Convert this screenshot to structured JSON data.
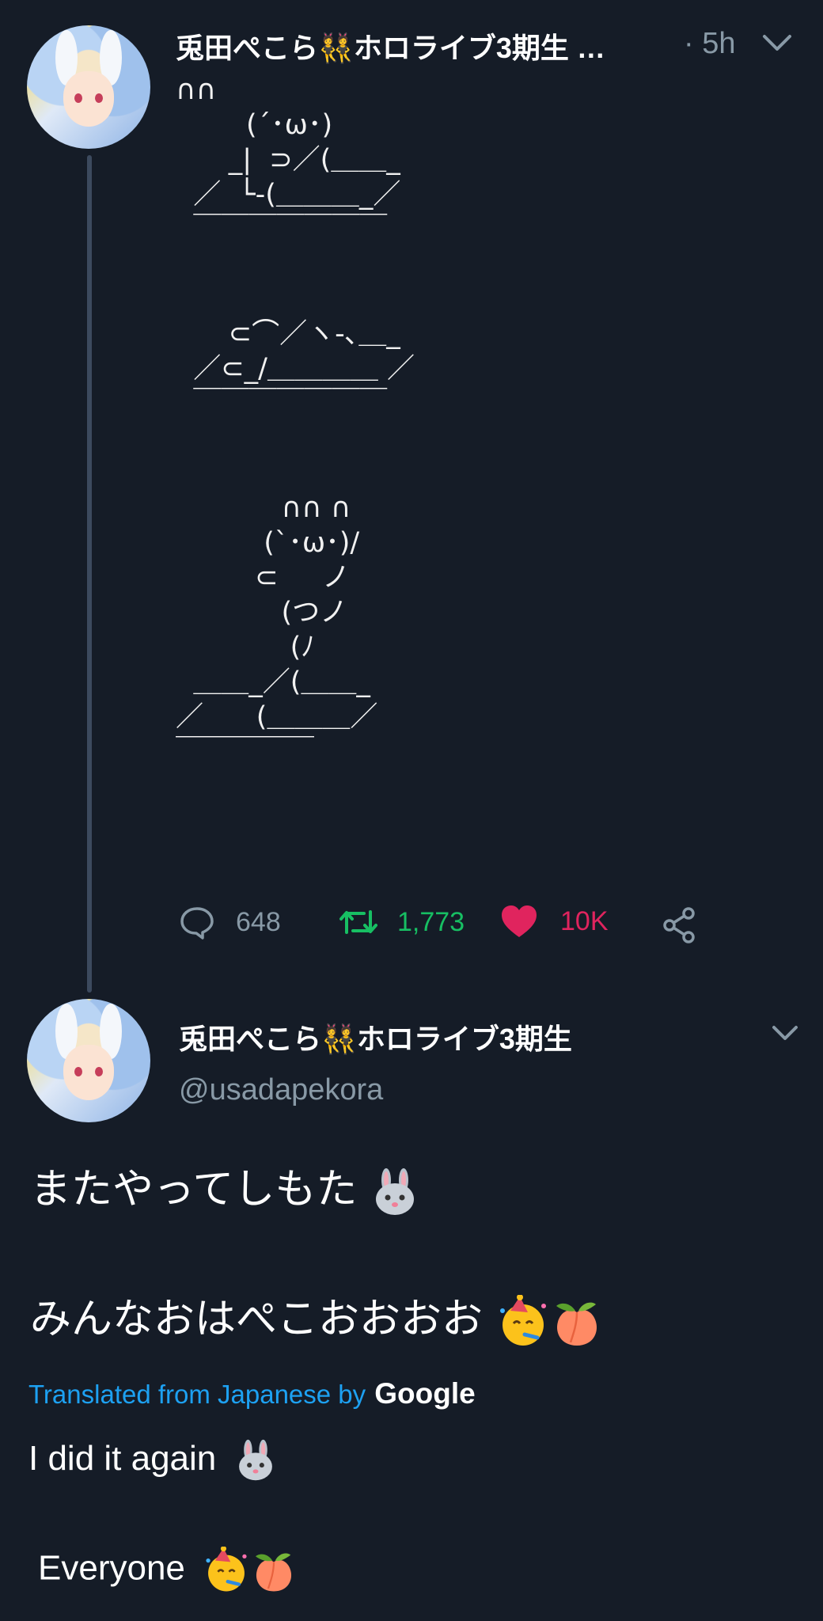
{
  "tweet1": {
    "display_name": "兎田ぺこら👯ホロライブ3期生 …",
    "time": "· 5h",
    "ascii_lines": [
      "∩∩",
      "        (´･ω･)",
      "      _|  ⊃／(＿＿_",
      "  ／  └-(＿＿＿_／",
      "  ￣￣￣￣￣￣￣",
      "",
      "",
      "      ⊂⌒／ヽ-､＿_",
      "  ／⊂_/＿＿＿＿ ／",
      "  ￣￣￣￣￣￣￣",
      "",
      "",
      "            ∩∩ ∩",
      "          (`･ω･)/",
      "         ⊂     ノ",
      "            (つノ",
      "             (ﾉ",
      "  ＿＿_／(＿＿_",
      "／      (＿＿＿／",
      "￣￣￣￣￣"
    ],
    "replies": "648",
    "retweets": "1,773",
    "likes": "10K"
  },
  "tweet2": {
    "display_name": "兎田ぺこら👯ホロライブ3期生",
    "handle": "@usadapekora",
    "line1": "またやってしもた",
    "line2": "みんなおはぺこおおおお",
    "translated_prefix": "Translated from Japanese by",
    "translated_by": "Google",
    "en_line1": "I did it again",
    "en_line2": "Everyone"
  },
  "colors": {
    "background": "#151c27",
    "retweet_green": "#17bf63",
    "like_pink": "#e0245e",
    "link_blue": "#1da1f2",
    "muted": "#8899a6"
  },
  "icons": [
    "reply-icon",
    "retweet-icon",
    "like-heart-icon",
    "share-icon",
    "chevron-down-icon",
    "rabbit-emoji",
    "party-face-emoji",
    "peach-emoji"
  ]
}
